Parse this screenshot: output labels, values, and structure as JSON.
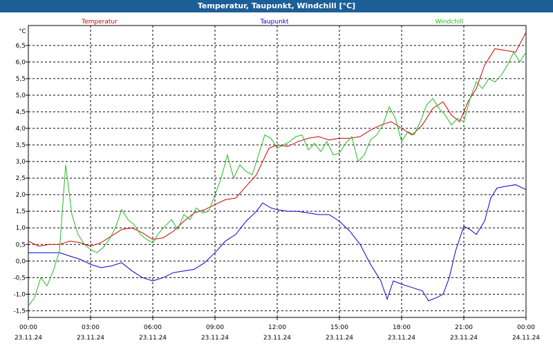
{
  "window": {
    "title": "Temperatur, Taupunkt, Windchill [°C]"
  },
  "chart_data": {
    "type": "line",
    "title": "Temperatur, Taupunkt, Windchill [°C]",
    "ylabel": "°C",
    "ylim": [
      -1.7,
      7.1
    ],
    "y_ticks": [
      "-1,5",
      "-1,0",
      "-0,5",
      "0,0",
      "0,5",
      "1,0",
      "1,5",
      "2,0",
      "2,5",
      "3,0",
      "3,5",
      "4,0",
      "4,5",
      "5,0",
      "5,5",
      "6,0",
      "6,5"
    ],
    "x_ticks": [
      {
        "time": "00:00",
        "date": "23.11.24"
      },
      {
        "time": "03:00",
        "date": "23.11.24"
      },
      {
        "time": "06:00",
        "date": "23.11.24"
      },
      {
        "time": "09:00",
        "date": "23.11.24"
      },
      {
        "time": "12:00",
        "date": "23.11.24"
      },
      {
        "time": "15:00",
        "date": "23.11.24"
      },
      {
        "time": "18:00",
        "date": "23.11.24"
      },
      {
        "time": "21:00",
        "date": "23.11.24"
      },
      {
        "time": "00:00",
        "date": "24.11.24"
      }
    ],
    "grid": true,
    "legend_position": "top",
    "series": [
      {
        "name": "Temperatur",
        "color": "#cc0000",
        "points": [
          [
            0.0,
            0.6
          ],
          [
            0.5,
            0.45
          ],
          [
            1.0,
            0.5
          ],
          [
            1.5,
            0.5
          ],
          [
            2.0,
            0.6
          ],
          [
            2.5,
            0.55
          ],
          [
            3.0,
            0.45
          ],
          [
            3.5,
            0.55
          ],
          [
            4.0,
            0.75
          ],
          [
            4.5,
            0.95
          ],
          [
            5.0,
            1.0
          ],
          [
            5.5,
            0.85
          ],
          [
            6.0,
            0.65
          ],
          [
            6.5,
            0.7
          ],
          [
            7.0,
            0.9
          ],
          [
            7.5,
            1.2
          ],
          [
            8.0,
            1.45
          ],
          [
            8.5,
            1.55
          ],
          [
            9.0,
            1.7
          ],
          [
            9.5,
            1.85
          ],
          [
            10.0,
            1.9
          ],
          [
            10.5,
            2.25
          ],
          [
            11.0,
            2.6
          ],
          [
            11.3,
            3.0
          ],
          [
            11.6,
            3.4
          ],
          [
            12.0,
            3.5
          ],
          [
            12.5,
            3.45
          ],
          [
            13.0,
            3.6
          ],
          [
            13.5,
            3.7
          ],
          [
            14.0,
            3.75
          ],
          [
            14.5,
            3.65
          ],
          [
            15.0,
            3.7
          ],
          [
            15.5,
            3.7
          ],
          [
            16.0,
            3.75
          ],
          [
            16.5,
            3.95
          ],
          [
            17.0,
            4.1
          ],
          [
            17.5,
            4.2
          ],
          [
            18.0,
            4.0
          ],
          [
            18.5,
            3.8
          ],
          [
            19.0,
            4.1
          ],
          [
            19.5,
            4.6
          ],
          [
            20.0,
            4.8
          ],
          [
            20.4,
            4.4
          ],
          [
            20.8,
            4.2
          ],
          [
            21.2,
            4.8
          ],
          [
            21.6,
            5.2
          ],
          [
            22.0,
            5.9
          ],
          [
            22.5,
            6.4
          ],
          [
            23.0,
            6.35
          ],
          [
            23.5,
            6.3
          ],
          [
            24.0,
            6.9
          ]
        ]
      },
      {
        "name": "Taupunkt",
        "color": "#0000cc",
        "points": [
          [
            0.0,
            0.25
          ],
          [
            0.5,
            0.25
          ],
          [
            1.0,
            0.25
          ],
          [
            1.5,
            0.25
          ],
          [
            2.0,
            0.15
          ],
          [
            2.5,
            0.05
          ],
          [
            3.0,
            -0.1
          ],
          [
            3.5,
            -0.2
          ],
          [
            4.0,
            -0.15
          ],
          [
            4.5,
            -0.05
          ],
          [
            5.0,
            -0.3
          ],
          [
            5.5,
            -0.5
          ],
          [
            6.0,
            -0.6
          ],
          [
            6.5,
            -0.5
          ],
          [
            7.0,
            -0.35
          ],
          [
            7.5,
            -0.3
          ],
          [
            8.0,
            -0.25
          ],
          [
            8.5,
            -0.05
          ],
          [
            9.0,
            0.25
          ],
          [
            9.5,
            0.6
          ],
          [
            10.0,
            0.8
          ],
          [
            10.5,
            1.2
          ],
          [
            11.0,
            1.5
          ],
          [
            11.3,
            1.75
          ],
          [
            11.7,
            1.6
          ],
          [
            12.0,
            1.55
          ],
          [
            12.5,
            1.5
          ],
          [
            13.0,
            1.5
          ],
          [
            13.5,
            1.45
          ],
          [
            14.0,
            1.4
          ],
          [
            14.5,
            1.4
          ],
          [
            15.0,
            1.2
          ],
          [
            15.5,
            0.9
          ],
          [
            16.0,
            0.5
          ],
          [
            16.5,
            -0.1
          ],
          [
            17.0,
            -0.6
          ],
          [
            17.3,
            -1.15
          ],
          [
            17.6,
            -0.6
          ],
          [
            18.0,
            -0.7
          ],
          [
            18.5,
            -0.8
          ],
          [
            19.0,
            -0.9
          ],
          [
            19.3,
            -1.2
          ],
          [
            19.7,
            -1.1
          ],
          [
            20.0,
            -1.0
          ],
          [
            20.3,
            -0.5
          ],
          [
            20.6,
            0.3
          ],
          [
            21.0,
            1.05
          ],
          [
            21.3,
            0.95
          ],
          [
            21.6,
            0.8
          ],
          [
            22.0,
            1.2
          ],
          [
            22.3,
            1.9
          ],
          [
            22.6,
            2.2
          ],
          [
            23.0,
            2.25
          ],
          [
            23.5,
            2.3
          ],
          [
            24.0,
            2.15
          ]
        ]
      },
      {
        "name": "Windchill",
        "color": "#22bb22",
        "points": [
          [
            0.0,
            -1.35
          ],
          [
            0.3,
            -1.1
          ],
          [
            0.6,
            -0.5
          ],
          [
            0.9,
            -0.75
          ],
          [
            1.2,
            -0.3
          ],
          [
            1.5,
            0.3
          ],
          [
            1.8,
            2.9
          ],
          [
            2.1,
            1.4
          ],
          [
            2.4,
            0.8
          ],
          [
            2.7,
            0.5
          ],
          [
            3.0,
            0.35
          ],
          [
            3.3,
            0.25
          ],
          [
            3.6,
            0.4
          ],
          [
            3.9,
            0.65
          ],
          [
            4.2,
            1.0
          ],
          [
            4.5,
            1.55
          ],
          [
            4.8,
            1.25
          ],
          [
            5.1,
            1.1
          ],
          [
            5.4,
            0.8
          ],
          [
            5.7,
            0.65
          ],
          [
            6.0,
            0.55
          ],
          [
            6.3,
            0.85
          ],
          [
            6.6,
            1.05
          ],
          [
            6.9,
            1.25
          ],
          [
            7.2,
            0.95
          ],
          [
            7.5,
            1.4
          ],
          [
            7.8,
            1.25
          ],
          [
            8.1,
            1.6
          ],
          [
            8.4,
            1.45
          ],
          [
            8.7,
            1.5
          ],
          [
            9.0,
            2.0
          ],
          [
            9.3,
            2.5
          ],
          [
            9.6,
            3.2
          ],
          [
            9.9,
            2.5
          ],
          [
            10.2,
            2.9
          ],
          [
            10.5,
            2.7
          ],
          [
            10.8,
            2.6
          ],
          [
            11.1,
            3.2
          ],
          [
            11.4,
            3.8
          ],
          [
            11.7,
            3.7
          ],
          [
            12.0,
            3.4
          ],
          [
            12.3,
            3.5
          ],
          [
            12.6,
            3.6
          ],
          [
            12.9,
            3.75
          ],
          [
            13.2,
            3.8
          ],
          [
            13.5,
            3.35
          ],
          [
            13.8,
            3.55
          ],
          [
            14.1,
            3.3
          ],
          [
            14.4,
            3.6
          ],
          [
            14.7,
            3.2
          ],
          [
            15.0,
            3.25
          ],
          [
            15.3,
            3.55
          ],
          [
            15.6,
            3.75
          ],
          [
            15.9,
            3.0
          ],
          [
            16.2,
            3.2
          ],
          [
            16.5,
            3.65
          ],
          [
            16.8,
            3.8
          ],
          [
            17.1,
            4.1
          ],
          [
            17.4,
            4.65
          ],
          [
            17.7,
            4.3
          ],
          [
            18.0,
            3.6
          ],
          [
            18.3,
            3.9
          ],
          [
            18.6,
            3.8
          ],
          [
            18.9,
            4.2
          ],
          [
            19.2,
            4.7
          ],
          [
            19.5,
            4.9
          ],
          [
            19.8,
            4.6
          ],
          [
            20.1,
            4.4
          ],
          [
            20.4,
            4.1
          ],
          [
            20.7,
            4.3
          ],
          [
            21.0,
            4.2
          ],
          [
            21.3,
            4.9
          ],
          [
            21.6,
            5.4
          ],
          [
            21.9,
            5.2
          ],
          [
            22.2,
            5.5
          ],
          [
            22.5,
            5.4
          ],
          [
            22.8,
            5.6
          ],
          [
            23.1,
            5.9
          ],
          [
            23.4,
            6.3
          ],
          [
            23.7,
            6.0
          ],
          [
            24.0,
            6.3
          ]
        ]
      }
    ]
  }
}
